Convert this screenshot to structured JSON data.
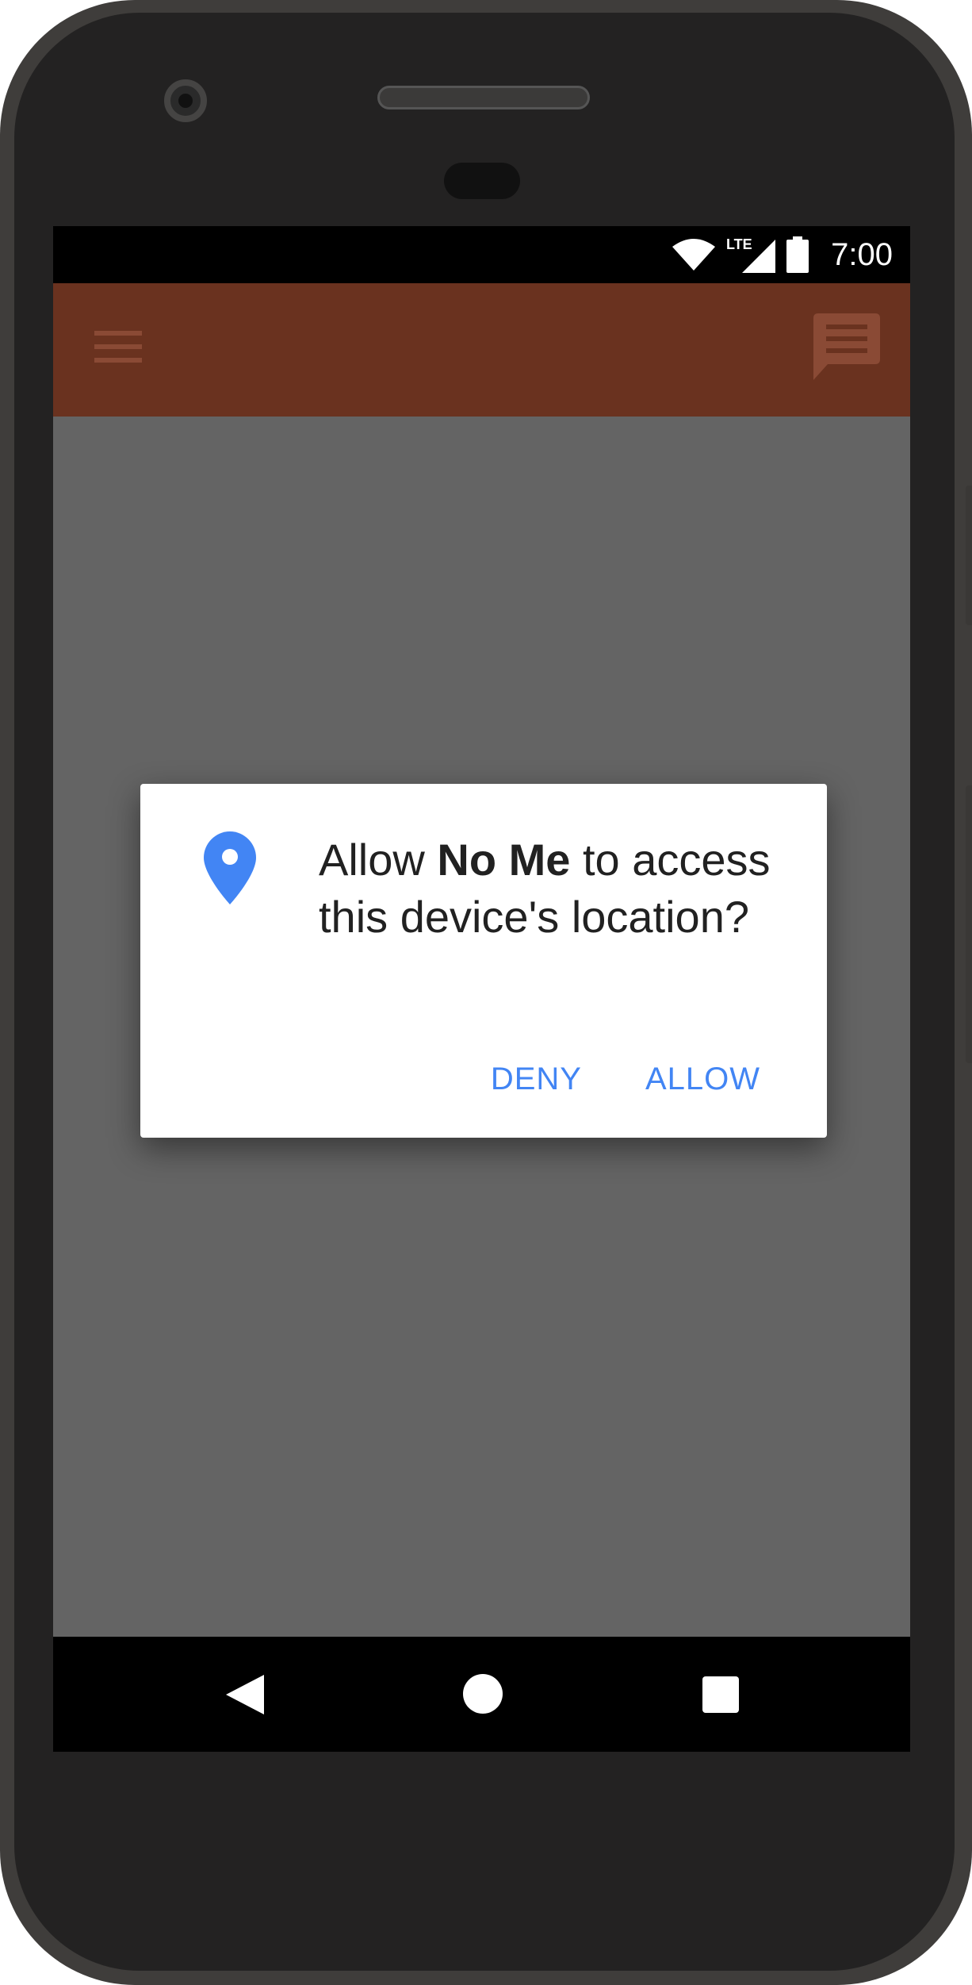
{
  "status_bar": {
    "time": "7:00",
    "network_label": "LTE",
    "icons": [
      "wifi-icon",
      "cell-signal-icon",
      "battery-icon"
    ]
  },
  "app_bar": {
    "color": "#6a321f",
    "icons": [
      "menu-icon",
      "chat-icon"
    ]
  },
  "dialog": {
    "icon": "location-pin-icon",
    "message_prefix": "Allow ",
    "app_name": "No Me",
    "message_suffix": " to access this device's location?",
    "deny_label": "DENY",
    "allow_label": "ALLOW",
    "accent_color": "#4285f4"
  },
  "nav_bar": {
    "icons": [
      "back-icon",
      "home-icon",
      "recents-icon"
    ]
  }
}
